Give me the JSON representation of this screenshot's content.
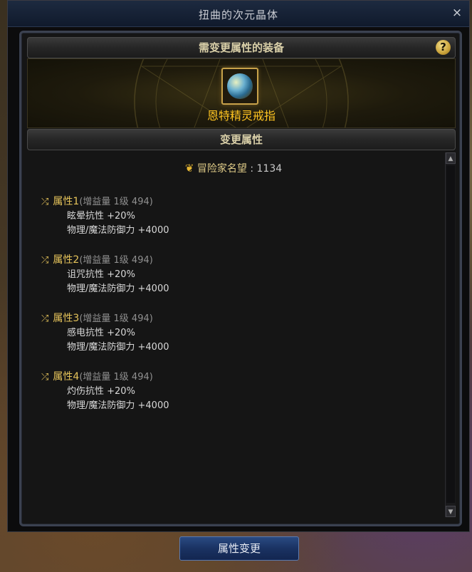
{
  "window": {
    "title": "扭曲的次元晶体",
    "close_icon": "×"
  },
  "equip_section": {
    "header": "需变更属性的装备",
    "help_icon": "?",
    "item_name": "恩特精灵戒指",
    "item_icon": "ring-icon"
  },
  "attr_section": {
    "header": "变更属性",
    "renown_label": "冒险家名望",
    "renown_sep": " : ",
    "renown_value": "1134",
    "attributes": [
      {
        "title": "属性1",
        "sub": "(增益量 1级 494)",
        "line1": "眩晕抗性 +20%",
        "line2": "物理/魔法防御力 +4000"
      },
      {
        "title": "属性2",
        "sub": "(增益量 1级 494)",
        "line1": "诅咒抗性 +20%",
        "line2": "物理/魔法防御力 +4000"
      },
      {
        "title": "属性3",
        "sub": "(增益量 1级 494)",
        "line1": "感电抗性 +20%",
        "line2": "物理/魔法防御力 +4000"
      },
      {
        "title": "属性4",
        "sub": "(增益量 1级 494)",
        "line1": "灼伤抗性 +20%",
        "line2": "物理/魔法防御力 +4000"
      }
    ]
  },
  "footer": {
    "change_button": "属性变更"
  },
  "colors": {
    "accent_gold": "#ffc421",
    "button_blue": "#1a3262"
  }
}
